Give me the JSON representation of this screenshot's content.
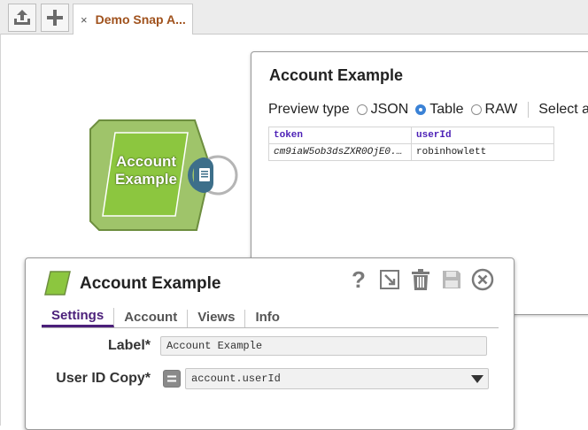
{
  "toolbar": {
    "upload_icon": "upload-icon",
    "add_icon": "plus-icon"
  },
  "tab": {
    "close_glyph": "×",
    "title": "Demo Snap A..."
  },
  "preview": {
    "title": "Account Example",
    "preview_type_label": "Preview type",
    "options": [
      {
        "label": "JSON",
        "selected": false
      },
      {
        "label": "Table",
        "selected": true
      },
      {
        "label": "RAW",
        "selected": false
      }
    ],
    "select_all_label": "Select all",
    "table": {
      "columns": [
        "token",
        "userId"
      ],
      "rows": [
        [
          "cm9iaW5ob3dsZXR0OjE0...",
          "robinhowlett"
        ]
      ]
    }
  },
  "snap": {
    "label_line1": "Account",
    "label_line2": "Example",
    "colors": {
      "fill": "#9fc46a",
      "inner": "#8cc63f",
      "port": "#3d6f8a"
    }
  },
  "dialog": {
    "title": "Account Example",
    "tools": [
      "help-icon",
      "expand-icon",
      "delete-icon",
      "save-icon",
      "close-icon"
    ],
    "tabs": [
      {
        "label": "Settings",
        "active": true
      },
      {
        "label": "Account",
        "active": false
      },
      {
        "label": "Views",
        "active": false
      },
      {
        "label": "Info",
        "active": false
      }
    ],
    "fields": {
      "label_label": "Label*",
      "label_value": "Account Example",
      "user_id_copy_label": "User ID Copy*",
      "user_id_copy_value": "account.userId"
    },
    "accent": "#4b1f7a"
  }
}
